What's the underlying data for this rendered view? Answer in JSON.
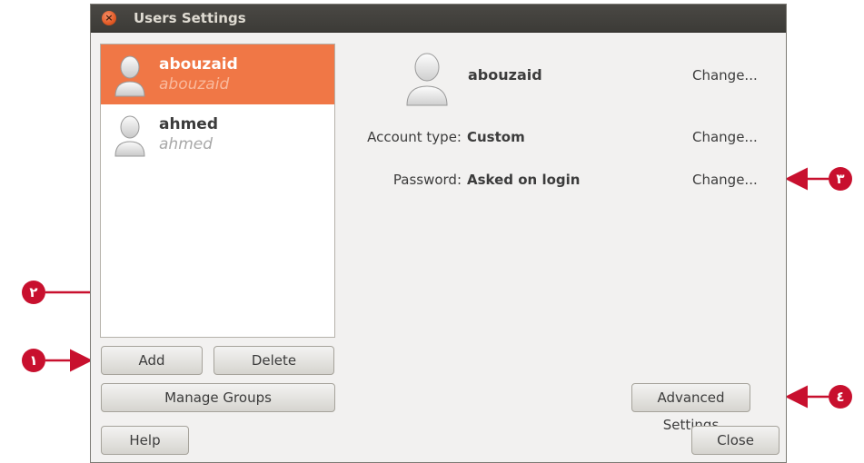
{
  "window": {
    "title": "Users Settings"
  },
  "users": [
    {
      "name": "abouzaid",
      "sub": "abouzaid",
      "selected": true
    },
    {
      "name": "ahmed",
      "sub": "ahmed",
      "selected": false
    }
  ],
  "details": {
    "username": "abouzaid",
    "account_type_label": "Account type:",
    "account_type_value": "Custom",
    "password_label": "Password:",
    "password_value": "Asked on login",
    "change_label": "Change..."
  },
  "buttons": {
    "add": "Add",
    "delete": "Delete",
    "manage_groups": "Manage Groups",
    "advanced_settings": "Advanced Settings",
    "help": "Help",
    "close": "Close"
  },
  "annotations": [
    "١",
    "٢",
    "٣",
    "٤"
  ],
  "colors": {
    "selection": "#f07746",
    "annotation": "#c8102e",
    "titlebar": "#3c3b37"
  }
}
